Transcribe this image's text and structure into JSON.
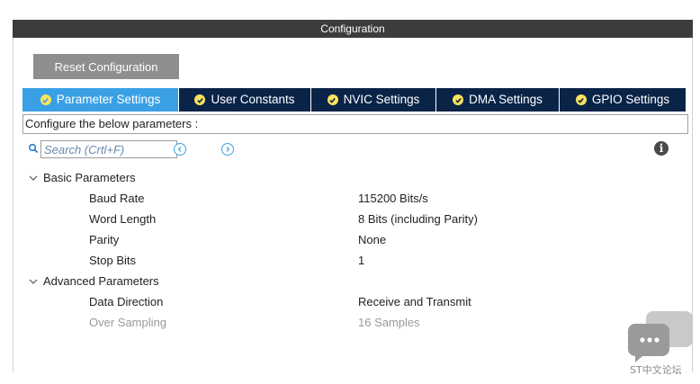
{
  "window": {
    "title": "Configuration"
  },
  "toolbar": {
    "reset_label": "Reset Configuration"
  },
  "tabs": [
    {
      "label": "Parameter Settings",
      "active": true
    },
    {
      "label": "User Constants",
      "active": false
    },
    {
      "label": "NVIC Settings",
      "active": false
    },
    {
      "label": "DMA Settings",
      "active": false
    },
    {
      "label": "GPIO Settings",
      "active": false
    }
  ],
  "description": "Configure the below parameters :",
  "search": {
    "placeholder": "Search (Crtl+F)",
    "value": ""
  },
  "groups": [
    {
      "label": "Basic Parameters",
      "params": [
        {
          "name": "Baud Rate",
          "value": "115200 Bits/s",
          "disabled": false
        },
        {
          "name": "Word Length",
          "value": "8 Bits (including Parity)",
          "disabled": false
        },
        {
          "name": "Parity",
          "value": "None",
          "disabled": false
        },
        {
          "name": "Stop Bits",
          "value": "1",
          "disabled": false
        }
      ]
    },
    {
      "label": "Advanced Parameters",
      "params": [
        {
          "name": "Data Direction",
          "value": "Receive and Transmit",
          "disabled": false
        },
        {
          "name": "Over Sampling",
          "value": "16 Samples",
          "disabled": true
        }
      ]
    }
  ],
  "watermark": {
    "text": "ST中文论坛",
    "icon": "chat-bubble-icon"
  },
  "colors": {
    "titlebar": "#3c3c3c",
    "tab_bar": "#0a2448",
    "tab_active": "#3aa0e6",
    "check": "#ffe35c",
    "reset_button": "#8e8e8e",
    "disabled_text": "#9a9a9a"
  }
}
